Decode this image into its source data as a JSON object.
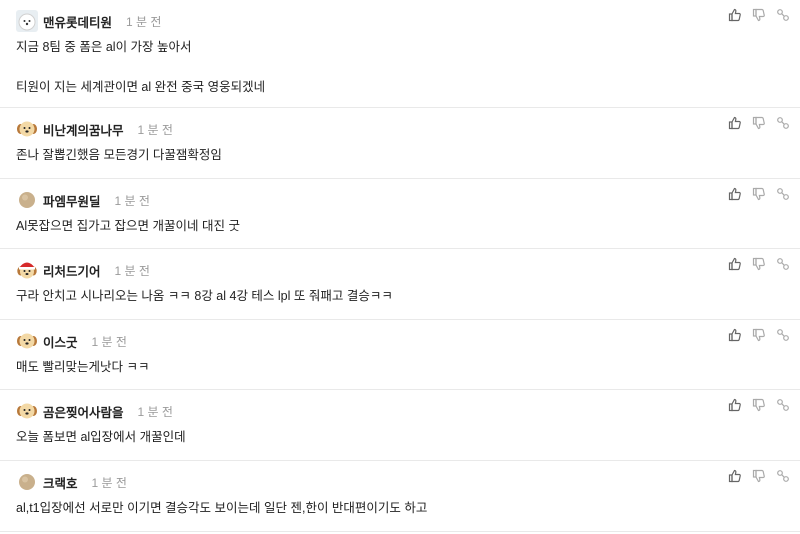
{
  "comments": [
    {
      "nick": "맨유롯데티원",
      "time": "1 분 전",
      "lines": [
        "지금 8팀 중 폼은 al이 가장 높아서",
        "",
        "티원이 지는 세계관이면 al 완전 중국 영웅되겠네"
      ],
      "avatar": "white-dog"
    },
    {
      "nick": "비난계의꿈나무",
      "time": "1 분 전",
      "lines": [
        "존나 잘뽑긴했음 모든경기 다꿀잼확정임"
      ],
      "avatar": "puppy"
    },
    {
      "nick": "파엠무원딜",
      "time": "1 분 전",
      "lines": [
        "Al못잡으면 집가고 잡으면 개꿀이네 대진 굿"
      ],
      "avatar": "circle"
    },
    {
      "nick": "리처드기어",
      "time": "1 분 전",
      "lines": [
        "구라 안치고 시나리오는 나옴 ㅋㅋ 8강 al 4강 테스 lpl 또 줘패고 결승ㅋㅋ"
      ],
      "avatar": "santa-dog"
    },
    {
      "nick": "이스굿",
      "time": "1 분 전",
      "lines": [
        "매도 빨리맞는게낫다 ㅋㅋ"
      ],
      "avatar": "puppy"
    },
    {
      "nick": "곰은찢어사람을",
      "time": "1 분 전",
      "lines": [
        "오늘 폼보면 al입장에서 개꿀인데"
      ],
      "avatar": "puppy"
    },
    {
      "nick": "크랙호",
      "time": "1 분 전",
      "lines": [
        "al,t1입장에선 서로만 이기면 결승각도 보이는데 일단 젠,한이 반대편이기도 하고"
      ],
      "avatar": "circle"
    }
  ],
  "icons": {
    "like": "thumbs-up-icon",
    "dislike": "thumbs-down-icon",
    "share": "share-link-icon"
  },
  "colors": {
    "text": "#222222",
    "time": "#9a9a9a",
    "icon": "#666666",
    "divider": "#e9e9e9"
  }
}
